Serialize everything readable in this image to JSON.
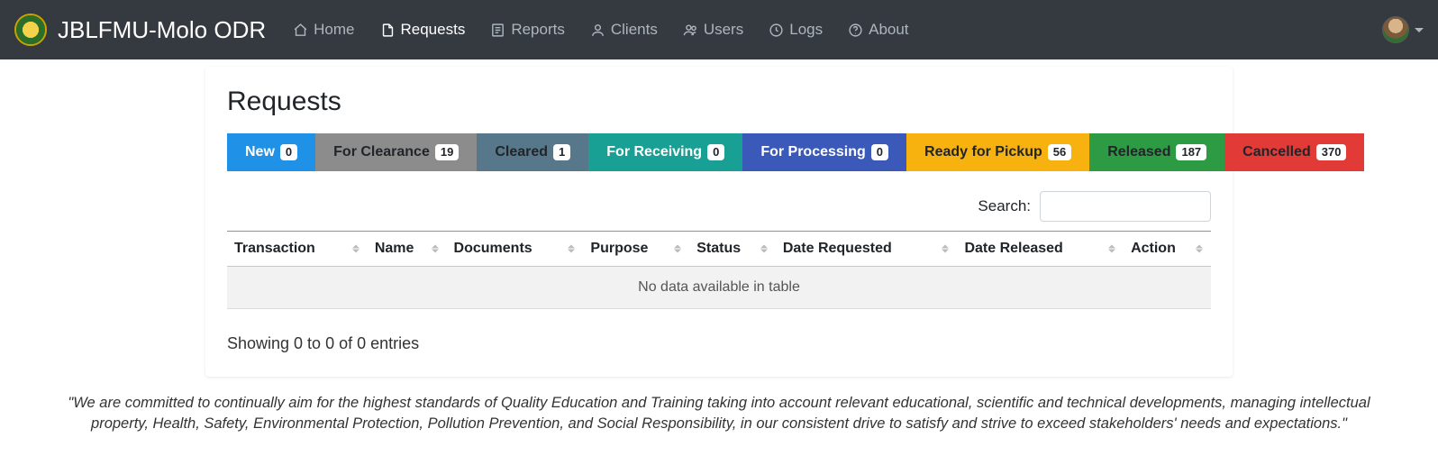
{
  "brand": {
    "title": "JBLFMU-Molo ODR"
  },
  "nav": {
    "items": [
      {
        "label": "Home",
        "active": false
      },
      {
        "label": "Requests",
        "active": true
      },
      {
        "label": "Reports",
        "active": false
      },
      {
        "label": "Clients",
        "active": false
      },
      {
        "label": "Users",
        "active": false
      },
      {
        "label": "Logs",
        "active": false
      },
      {
        "label": "About",
        "active": false
      }
    ]
  },
  "page": {
    "title": "Requests"
  },
  "tabs": [
    {
      "label": "New",
      "count": "0"
    },
    {
      "label": "For Clearance",
      "count": "19"
    },
    {
      "label": "Cleared",
      "count": "1"
    },
    {
      "label": "For Receiving",
      "count": "0"
    },
    {
      "label": "For Processing",
      "count": "0"
    },
    {
      "label": "Ready for Pickup",
      "count": "56"
    },
    {
      "label": "Released",
      "count": "187"
    },
    {
      "label": "Cancelled",
      "count": "370"
    }
  ],
  "search": {
    "label": "Search:",
    "value": ""
  },
  "table": {
    "columns": [
      "Transaction",
      "Name",
      "Documents",
      "Purpose",
      "Status",
      "Date Requested",
      "Date Released",
      "Action"
    ],
    "empty_message": "No data available in table",
    "info": "Showing 0 to 0 of 0 entries"
  },
  "footer": {
    "quote": "\"We are committed to continually aim for the highest standards of Quality Education and Training taking into account relevant educational, scientific and technical developments, managing intellectual property, Health, Safety, Environmental Protection, Pollution Prevention, and Social Responsibility, in our consistent drive to satisfy and strive to exceed stakeholders' needs and expectations.\""
  }
}
